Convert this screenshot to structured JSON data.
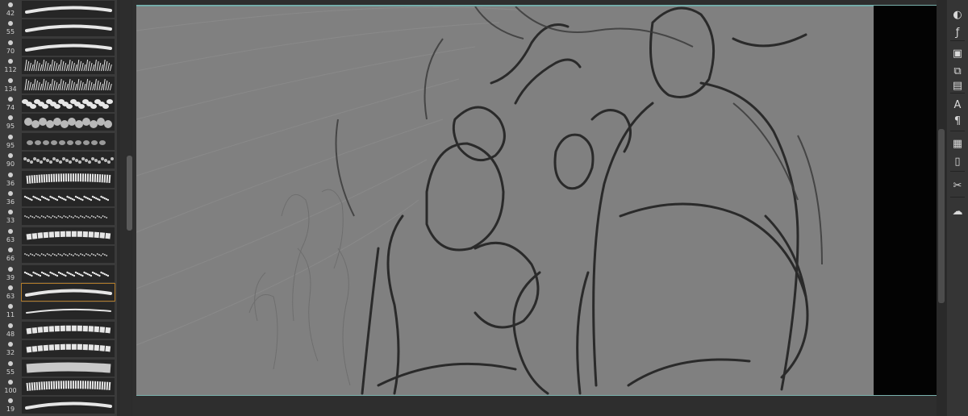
{
  "brush_panel": {
    "brushes": [
      {
        "size": "42",
        "icon": "brush-preset-icon",
        "stroke": "smooth"
      },
      {
        "size": "55",
        "icon": "brush-preset-icon",
        "stroke": "smooth"
      },
      {
        "size": "70",
        "icon": "brush-preset-icon",
        "stroke": "smooth"
      },
      {
        "size": "112",
        "icon": "brush-preset-icon",
        "stroke": "grass"
      },
      {
        "size": "134",
        "icon": "brush-preset-icon",
        "stroke": "grass"
      },
      {
        "size": "74",
        "icon": "brush-preset-icon",
        "stroke": "leaves"
      },
      {
        "size": "95",
        "icon": "brush-preset-icon",
        "stroke": "blobs"
      },
      {
        "size": "95",
        "icon": "brush-preset-icon",
        "stroke": "petals"
      },
      {
        "size": "90",
        "icon": "brush-preset-icon",
        "stroke": "pebble"
      },
      {
        "size": "36",
        "icon": "brush-preset-icon",
        "stroke": "chalk"
      },
      {
        "size": "36",
        "icon": "brush-preset-icon",
        "stroke": "speckle"
      },
      {
        "size": "33",
        "icon": "brush-preset-icon",
        "stroke": "thin-speckle"
      },
      {
        "size": "63",
        "icon": "brush-preset-icon",
        "stroke": "rough"
      },
      {
        "size": "66",
        "icon": "brush-preset-icon",
        "stroke": "thin-speckle"
      },
      {
        "size": "39",
        "icon": "brush-preset-icon",
        "stroke": "speckle"
      },
      {
        "size": "63",
        "icon": "brush-preset-icon",
        "stroke": "smooth",
        "selected": true
      },
      {
        "size": "11",
        "icon": "brush-preset-icon",
        "stroke": "thin"
      },
      {
        "size": "48",
        "icon": "brush-preset-icon",
        "stroke": "rough"
      },
      {
        "size": "32",
        "icon": "brush-preset-icon",
        "stroke": "rough"
      },
      {
        "size": "55",
        "icon": "brush-preset-icon",
        "stroke": "wide"
      },
      {
        "size": "100",
        "icon": "brush-preset-icon",
        "stroke": "chalk"
      },
      {
        "size": "19",
        "icon": "brush-preset-icon",
        "stroke": "smooth"
      }
    ]
  },
  "right_toolbar": {
    "tools": [
      {
        "name": "color-wheel-icon"
      },
      {
        "name": "fx-icon"
      },
      {
        "name": "brush-settings-icon"
      },
      {
        "name": "navigator-icon"
      },
      {
        "name": "layer-panel-icon"
      },
      {
        "name": "text-tool-icon"
      },
      {
        "name": "paragraph-icon"
      },
      {
        "name": "layout-icon"
      },
      {
        "name": "notes-icon"
      },
      {
        "name": "tools-icon"
      },
      {
        "name": "creative-cloud-icon"
      }
    ]
  },
  "canvas": {
    "background_color": "#808080",
    "accent_color": "#7ab2ae",
    "selected_color": "#b07a2a"
  }
}
